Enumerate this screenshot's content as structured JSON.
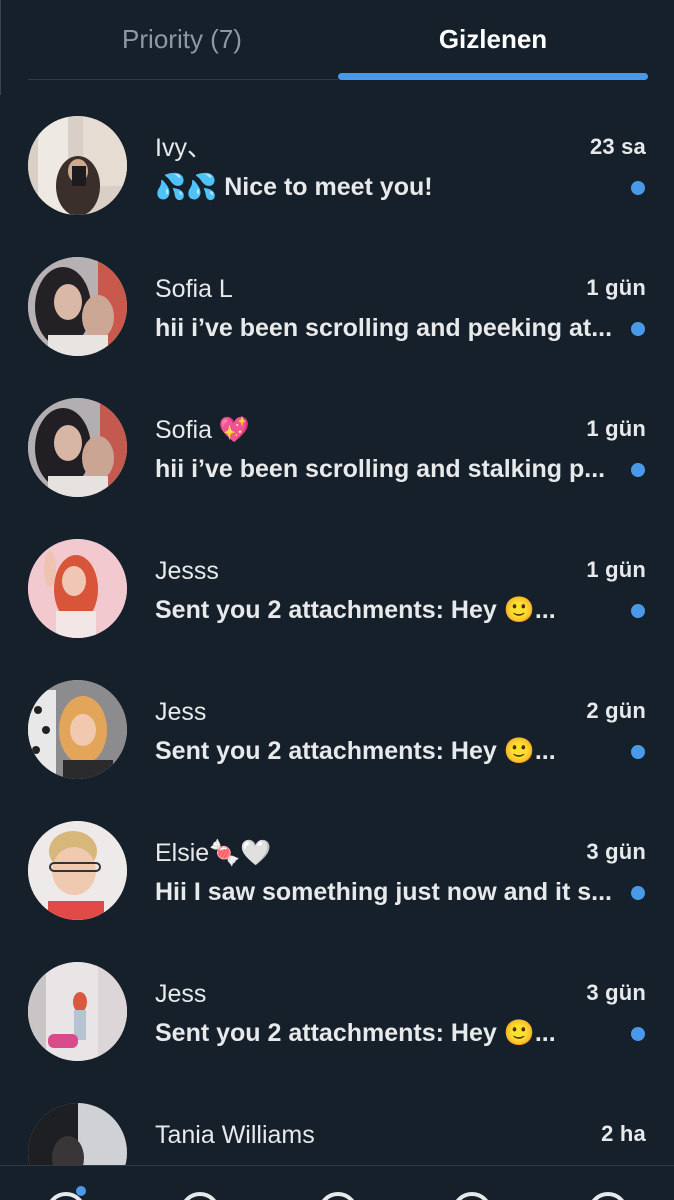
{
  "tabs": [
    {
      "label": "Priority (7)",
      "active": false
    },
    {
      "label": "Gizlenen",
      "active": true
    }
  ],
  "accent_color": "#4a99e9",
  "conversations": [
    {
      "name": "Ivy、",
      "time": "23 sa",
      "preview": "💦💦 Nice to meet you!",
      "unread": true
    },
    {
      "name": "Sofia L",
      "time": "1 gün",
      "preview": "hii i’ve been scrolling and peeking at...",
      "unread": true
    },
    {
      "name": "Sofia 💖",
      "time": "1 gün",
      "preview": "hii i’ve been scrolling and stalking p...",
      "unread": true
    },
    {
      "name": "Jesss",
      "time": "1 gün",
      "preview": "Sent you 2 attachments: Hey 🙂...",
      "unread": true
    },
    {
      "name": "Jess",
      "time": "2 gün",
      "preview": "Sent you 2 attachments: Hey 🙂...",
      "unread": true
    },
    {
      "name": "Elsie🍬🤍",
      "time": "3 gün",
      "preview": "Hii I saw something just now and it s...",
      "unread": true
    },
    {
      "name": "Jess",
      "time": "3 gün",
      "preview": "Sent you 2 attachments: Hey 🙂...",
      "unread": true
    },
    {
      "name": "Tania Williams",
      "time": "2 ha",
      "preview": "",
      "unread": false
    }
  ],
  "bottom_nav": {
    "icons": [
      "home-icon",
      "search-icon",
      "grok-icon",
      "notifications-icon",
      "messages-icon"
    ]
  }
}
